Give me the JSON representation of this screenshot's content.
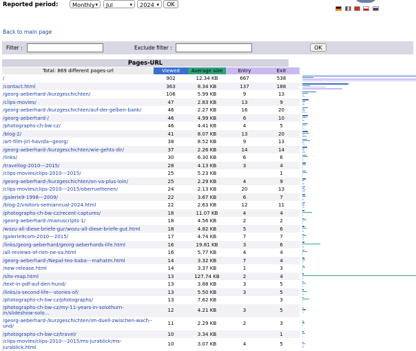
{
  "header": {
    "period_label": "Reported period:",
    "type_value": "Monthly",
    "month_value": "Jul",
    "year_value": "2024",
    "ok_label": "OK",
    "flags": [
      "de-flag-icon",
      "fr-flag-icon",
      "ch-flag-icon",
      "cz-flag-icon",
      "ru-flag-icon"
    ]
  },
  "back_link": "Back to main page",
  "filter": {
    "filter_label": "Filter :",
    "filter_value": "",
    "exclude_label": "Exclude filter :",
    "exclude_value": "",
    "ok_label": "OK"
  },
  "section_title": "Pages-URL",
  "table": {
    "total_label": "Total: 869 different pages-url",
    "col_viewed": "Viewed",
    "col_size": "Average size",
    "col_entry": "Entry",
    "col_exit": "Exit",
    "max_viewed": 902,
    "max_size": 127.74,
    "rows": [
      {
        "url": "/",
        "viewed": "902",
        "size": "12.34 KB",
        "entry": "667",
        "exit": "538"
      },
      {
        "url": "/contact.html",
        "viewed": "363",
        "size": "8.34 KB",
        "entry": "137",
        "exit": "188"
      },
      {
        "url": "/georg-aeberhard-/kurzgeschichten/",
        "viewed": "106",
        "size": "5.99 KB",
        "entry": "9",
        "exit": "13"
      },
      {
        "url": "/clips-movies/",
        "viewed": "47",
        "size": "2.83 KB",
        "entry": "13",
        "exit": "9"
      },
      {
        "url": "/georg-aeberhard-/kurzgeschichten/auf-der-gelben-bank/",
        "viewed": "46",
        "size": "2.27 KB",
        "entry": "16",
        "exit": "20"
      },
      {
        "url": "/georg-aeberhard-/",
        "viewed": "46",
        "size": "4.99 KB",
        "entry": "6",
        "exit": "10"
      },
      {
        "url": "/photographs-ch-bw-cz/",
        "viewed": "46",
        "size": "4.41 KB",
        "entry": "4",
        "exit": "5"
      },
      {
        "url": "/blog-2/",
        "viewed": "41",
        "size": "8.07 KB",
        "entry": "13",
        "exit": "20"
      },
      {
        "url": "/art-film-jiri-havrda--georg/",
        "viewed": "38",
        "size": "8.52 KB",
        "entry": "9",
        "exit": "13"
      },
      {
        "url": "/georg-aeberhard-/kurzgeschichten/wie-gehts-dir/",
        "viewed": "37",
        "size": "2.26 KB",
        "entry": "14",
        "exit": "14"
      },
      {
        "url": "/links/",
        "viewed": "30",
        "size": "6.30 KB",
        "entry": "6",
        "exit": "6"
      },
      {
        "url": "/travellog-2010---2015/",
        "viewed": "28",
        "size": "4.13 KB",
        "entry": "3",
        "exit": "4"
      },
      {
        "url": "/clips-movies/clips-2010---2015/",
        "viewed": "25",
        "size": "5.23 KB",
        "entry": "",
        "exit": "1"
      },
      {
        "url": "/georg-aeberhard-/kurzgeschichten/on-va-plus-loin/",
        "viewed": "25",
        "size": "2.29 KB",
        "entry": "4",
        "exit": "9"
      },
      {
        "url": "/clips-movies/clips-2010---2015/oberruettenen/",
        "viewed": "24",
        "size": "2.13 KB",
        "entry": "20",
        "exit": "13"
      },
      {
        "url": "/galerie9-1998---2009/",
        "viewed": "22",
        "size": "3.67 KB",
        "entry": "6",
        "exit": "7"
      },
      {
        "url": "/blog-2/visitors-semiannual-2024.html",
        "viewed": "22",
        "size": "2.63 KB",
        "entry": "12",
        "exit": "11"
      },
      {
        "url": "/photographs-ch-bw-cz/recent-captures/",
        "viewed": "18",
        "size": "11.07 KB",
        "entry": "4",
        "exit": "4"
      },
      {
        "url": "/georg-aeberhard-/manuscripts-1/",
        "viewed": "18",
        "size": "4.56 KB",
        "entry": "2",
        "exit": "2"
      },
      {
        "url": "/wozu-all-diese-briefe-gur/wozu-all-diese-briefe-gut.html",
        "viewed": "18",
        "size": "4.82 KB",
        "entry": "5",
        "exit": "6"
      },
      {
        "url": "/galerie9com-2010---2015/",
        "viewed": "17",
        "size": "4.74 KB",
        "entry": "7",
        "exit": "7"
      },
      {
        "url": "/links/georg-aeberhard/georg-aeberhards-life.html",
        "viewed": "16",
        "size": "19.81 KB",
        "entry": "3",
        "exit": "6"
      },
      {
        "url": "/all-reviews-of-rien-ne-va.html",
        "viewed": "16",
        "size": "5.77 KB",
        "entry": "4",
        "exit": "4"
      },
      {
        "url": "/georg-aeberhard-/Nepal-teo-baba---mahatm.html",
        "viewed": "14",
        "size": "3.32 KB",
        "entry": "7",
        "exit": "4"
      },
      {
        "url": "/new-release.html",
        "viewed": "14",
        "size": "3.37 KB",
        "entry": "1",
        "exit": "3"
      },
      {
        "url": "/site-map.html",
        "viewed": "13",
        "size": "127.74 KB",
        "entry": "2",
        "exit": "4"
      },
      {
        "url": "/text-in-pdf-auf-den-hund/",
        "viewed": "13",
        "size": "3.88 KB",
        "entry": "3",
        "exit": "5"
      },
      {
        "url": "/links/a-second-life---stories-of/",
        "viewed": "13",
        "size": "5.50 KB",
        "entry": "3",
        "exit": "5"
      },
      {
        "url": "/photographs-ch-bw-cz/photographs/",
        "viewed": "13",
        "size": "7.62 KB",
        "entry": "",
        "exit": "3"
      },
      {
        "url": "/photographs-ch-bw-cz/my-11-years-in-solothurn-in/slideshow-solo...",
        "viewed": "12",
        "size": "4.21 KB",
        "entry": "3",
        "exit": "5",
        "twoline": true
      },
      {
        "url": "/georg-aeberhard-/kurzgeschichten/im-duell-zwischen-wach--und/",
        "viewed": "11",
        "size": "2.29 KB",
        "entry": "2",
        "exit": "3",
        "twoline": true
      },
      {
        "url": "/photographs-ch-bw-cz/travel/",
        "viewed": "10",
        "size": "3.34 KB",
        "entry": "",
        "exit": "1"
      },
      {
        "url": "/clips-movies/clips-2010---2015/ms-jurablick/ms-jurablick.html",
        "viewed": "10",
        "size": "3.07 KB",
        "entry": "4",
        "exit": "5",
        "twoline": true
      }
    ]
  }
}
